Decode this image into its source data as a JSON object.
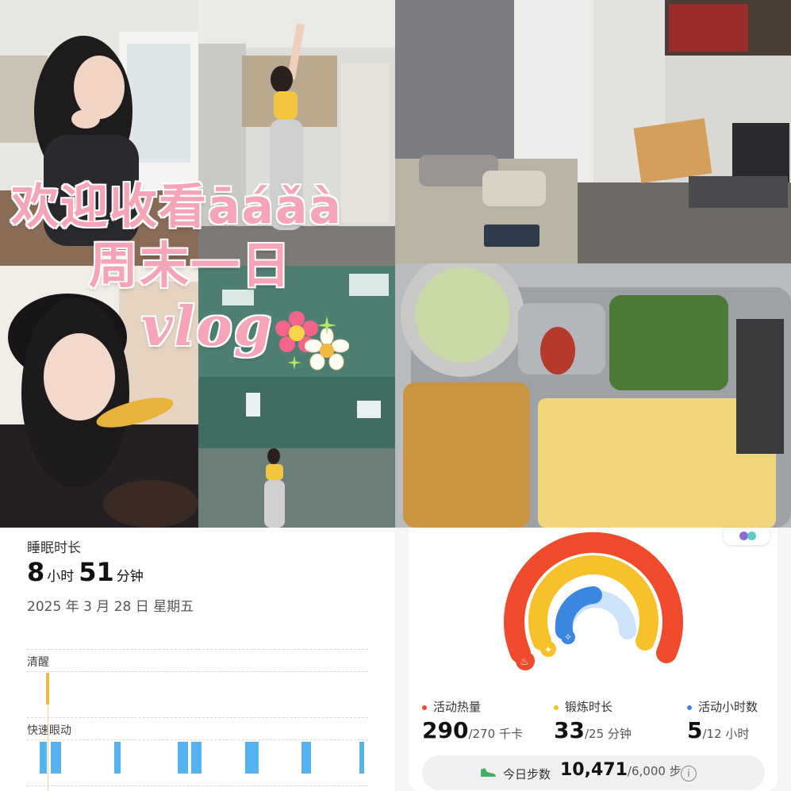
{
  "overlay": {
    "title_line1": "欢迎收看āáǎà",
    "title_line2": "周末一日",
    "title_line3": "vlog"
  },
  "photos": [
    {
      "name": "girl-glasses-at-desk"
    },
    {
      "name": "girl-stretching-in-dorm"
    },
    {
      "name": "dorm-bed-and-desk"
    },
    {
      "name": "girl-eating-with-spoon"
    },
    {
      "name": "girl-in-gym"
    },
    {
      "name": "cafeteria-food-tray"
    }
  ],
  "sleep": {
    "title": "睡眠时长",
    "hours": "8",
    "hours_unit": "小时",
    "minutes": "51",
    "minutes_unit": "分钟",
    "date": "2025 年 3 月 28 日  星期五",
    "stage_awake": "清醒",
    "stage_rem": "快速眼动"
  },
  "activity": {
    "calories_label": "活动热量",
    "calories_value": "290",
    "calories_goal": "/270 千卡",
    "exercise_label": "锻炼时长",
    "exercise_value": "33",
    "exercise_goal": "/25 分钟",
    "stand_label": "活动小时数",
    "stand_value": "5",
    "stand_goal": "/12 小时",
    "steps_label": "今日步数",
    "steps_value": "10,471",
    "steps_goal": "/6,000 步",
    "info_glyph": "i",
    "colors": {
      "calories": "#f04a2c",
      "exercise": "#f7c12b",
      "stand": "#3a86e0"
    }
  }
}
